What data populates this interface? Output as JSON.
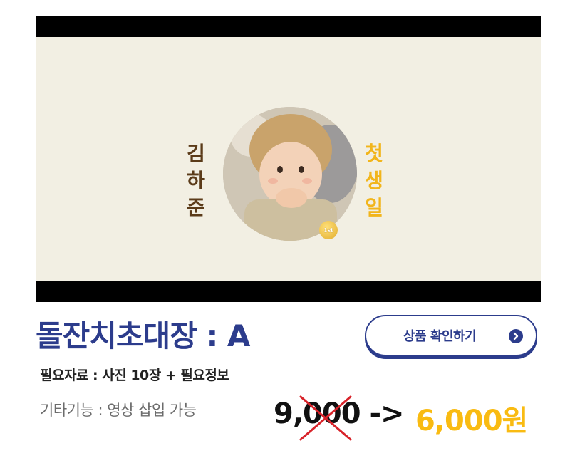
{
  "preview": {
    "name_chars": [
      "김",
      "하",
      "준"
    ],
    "title_chars": [
      "첫",
      "생",
      "일"
    ],
    "badge_text": "1st"
  },
  "product": {
    "title": "돌잔치초대장 : A",
    "check_button_label": "상품 확인하기",
    "required": "필요자료 : 사진 10장 + 필요정보",
    "extra": "기타기능 : 영상 삽입 가능",
    "price_old": "9,000 ->",
    "price_new": "6,000원"
  },
  "colors": {
    "brand": "#2c3c8c",
    "price_highlight": "#f9bb12",
    "strike": "#d8232a",
    "preview_bg": "#f2efe3",
    "name": "#5b3b19",
    "title": "#f2b51b"
  },
  "icons": [
    "chevron-right-circle-icon",
    "strike-x-icon"
  ]
}
